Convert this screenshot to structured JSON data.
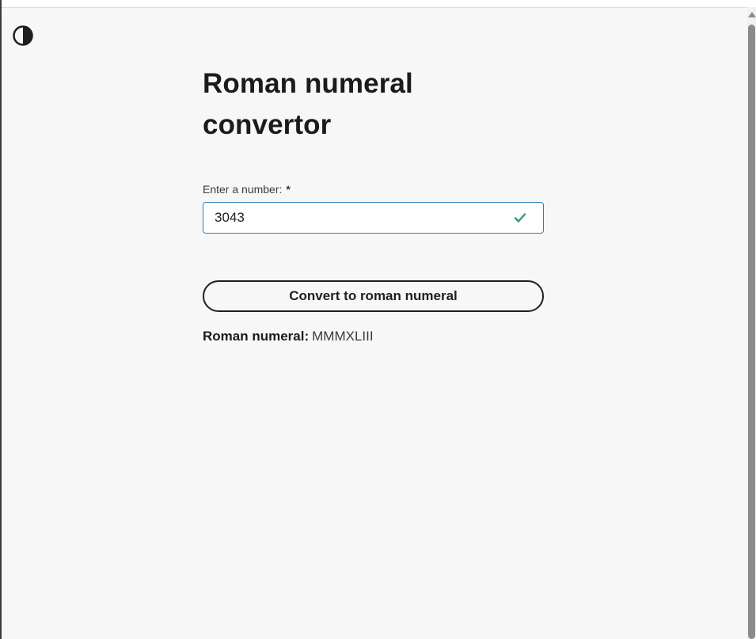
{
  "page": {
    "title": "Roman numeral convertor"
  },
  "theme_toggle": {
    "icon": "contrast-half-moon-icon"
  },
  "form": {
    "label": "Enter a number:",
    "required_mark": "*",
    "input_value": "3043",
    "valid_icon": "check-icon",
    "valid_color": "#2e9e6e"
  },
  "button": {
    "label": "Convert to roman numeral"
  },
  "result": {
    "label": "Roman numeral:",
    "value": "MMMXLIII"
  },
  "colors": {
    "background": "#f7f7f7",
    "input_border": "#2b7fb6",
    "text": "#1f1f1f"
  }
}
